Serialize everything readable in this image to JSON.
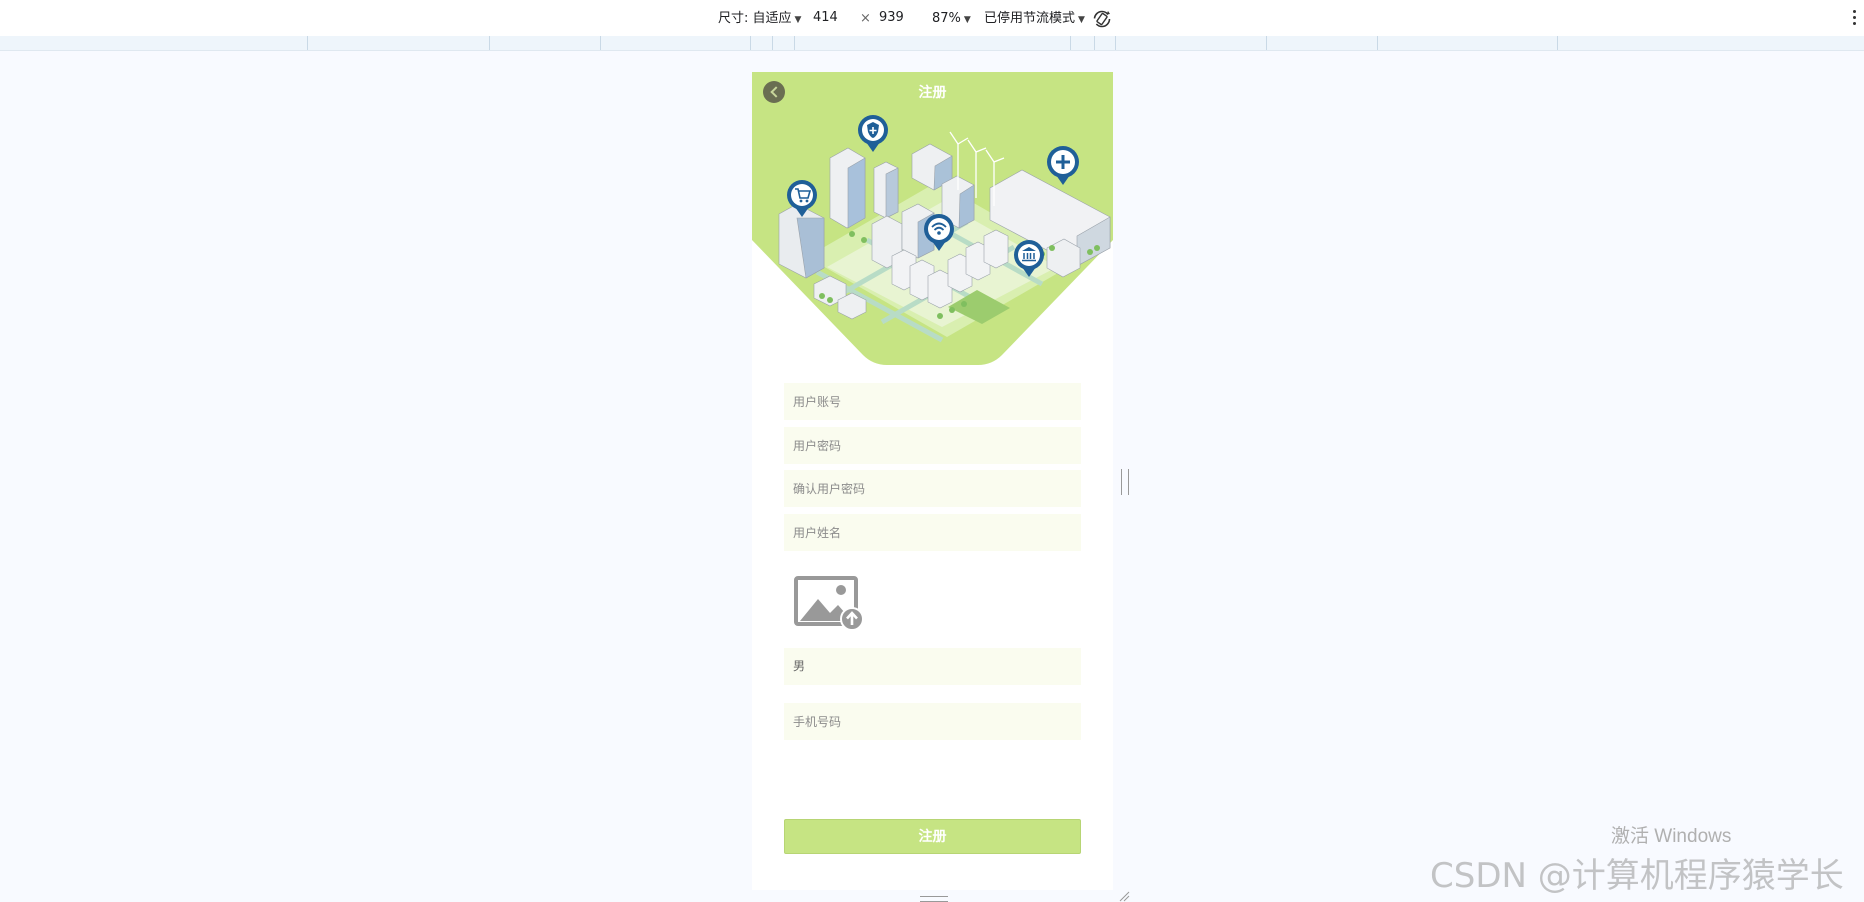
{
  "devtools": {
    "dimensions_label": "尺寸: 自适应",
    "width_value": "414",
    "times_symbol": "×",
    "height_value": "939",
    "zoom": "87%",
    "throttle": "已停用节流模式",
    "icons": [
      "caret-down-icon",
      "rotate-icon",
      "more-vertical-icon"
    ]
  },
  "page": {
    "title": "注册",
    "back_icon": "back-arrow-icon",
    "illustration": "smart-city-isometric-illustration",
    "pin_icons": [
      "shield-pin-icon",
      "cart-pin-icon",
      "wifi-pin-icon",
      "plus-pin-icon",
      "bank-pin-icon"
    ]
  },
  "form": {
    "account_placeholder": "用户账号",
    "password_placeholder": "用户密码",
    "confirm_password_placeholder": "确认用户密码",
    "name_placeholder": "用户姓名",
    "photo_upload_icon": "image-upload-icon",
    "gender_value": "男",
    "phone_placeholder": "手机号码",
    "submit_label": "注册"
  },
  "colors": {
    "accent": "#c6e483",
    "field_bg": "#fafcef",
    "pin_blue": "#1f5f98"
  },
  "overlay": {
    "windows_activation": "激活 Windows",
    "watermark": "CSDN @计算机程序猿学长"
  }
}
